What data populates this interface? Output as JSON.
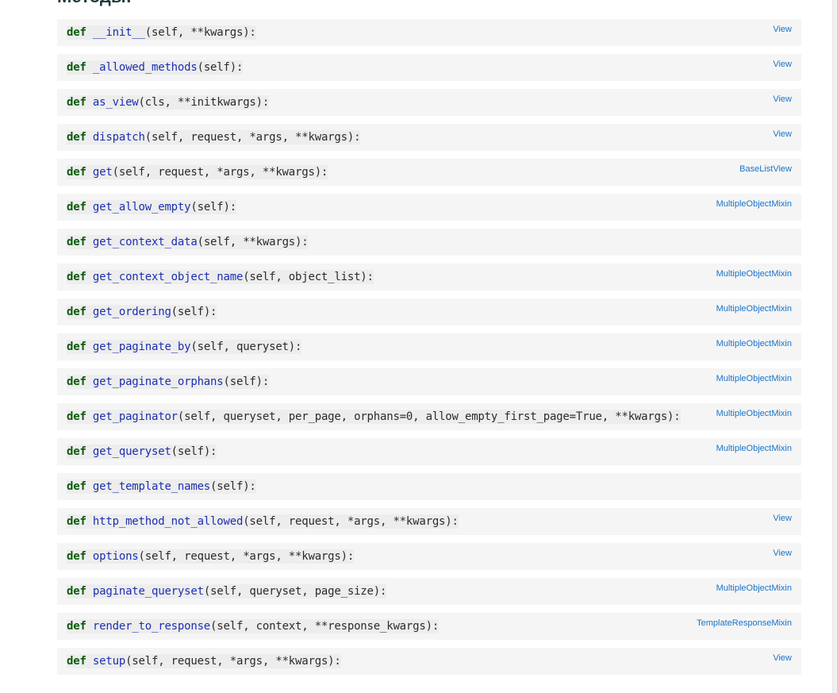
{
  "section": {
    "title": "Методы:"
  },
  "methods": [
    {
      "keyword": "def",
      "name": "__init__",
      "args": "(self, **kwargs):",
      "defined_in": "View"
    },
    {
      "keyword": "def",
      "name": "_allowed_methods",
      "args": "(self):",
      "defined_in": "View"
    },
    {
      "keyword": "def",
      "name": "as_view",
      "args": "(cls, **initkwargs):",
      "defined_in": "View"
    },
    {
      "keyword": "def",
      "name": "dispatch",
      "args": "(self, request, *args, **kwargs):",
      "defined_in": "View"
    },
    {
      "keyword": "def",
      "name": "get",
      "args": "(self, request, *args, **kwargs):",
      "defined_in": "BaseListView"
    },
    {
      "keyword": "def",
      "name": "get_allow_empty",
      "args": "(self):",
      "defined_in": "MultipleObjectMixin"
    },
    {
      "keyword": "def",
      "name": "get_context_data",
      "args": "(self, **kwargs):",
      "defined_in": ""
    },
    {
      "keyword": "def",
      "name": "get_context_object_name",
      "args": "(self, object_list):",
      "defined_in": "MultipleObjectMixin"
    },
    {
      "keyword": "def",
      "name": "get_ordering",
      "args": "(self):",
      "defined_in": "MultipleObjectMixin"
    },
    {
      "keyword": "def",
      "name": "get_paginate_by",
      "args": "(self, queryset):",
      "defined_in": "MultipleObjectMixin"
    },
    {
      "keyword": "def",
      "name": "get_paginate_orphans",
      "args": "(self):",
      "defined_in": "MultipleObjectMixin"
    },
    {
      "keyword": "def",
      "name": "get_paginator",
      "args": "(self, queryset, per_page, orphans=0, allow_empty_first_page=True, **kwargs):",
      "defined_in": "MultipleObjectMixin"
    },
    {
      "keyword": "def",
      "name": "get_queryset",
      "args": "(self):",
      "defined_in": "MultipleObjectMixin"
    },
    {
      "keyword": "def",
      "name": "get_template_names",
      "args": "(self):",
      "defined_in": ""
    },
    {
      "keyword": "def",
      "name": "http_method_not_allowed",
      "args": "(self, request, *args, **kwargs):",
      "defined_in": "View"
    },
    {
      "keyword": "def",
      "name": "options",
      "args": "(self, request, *args, **kwargs):",
      "defined_in": "View"
    },
    {
      "keyword": "def",
      "name": "paginate_queryset",
      "args": "(self, queryset, page_size):",
      "defined_in": "MultipleObjectMixin"
    },
    {
      "keyword": "def",
      "name": "render_to_response",
      "args": "(self, context, **response_kwargs):",
      "defined_in": "TemplateResponseMixin"
    },
    {
      "keyword": "def",
      "name": "setup",
      "args": "(self, request, *args, **kwargs):",
      "defined_in": "View"
    }
  ]
}
